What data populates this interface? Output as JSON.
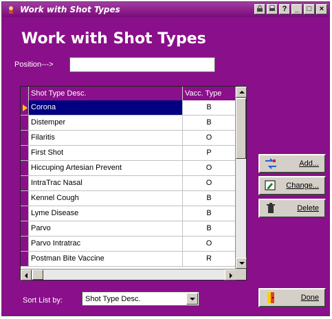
{
  "window": {
    "title": "Work with Shot Types",
    "controls": [
      "lock-icon",
      "print-icon",
      "help-icon",
      "minimize-icon",
      "maximize-icon",
      "close-icon"
    ],
    "control_glyphs": {
      "help": "?",
      "minimize": "_",
      "maximize": "□",
      "close": "×"
    }
  },
  "heading": "Work with Shot Types",
  "position": {
    "label": "Position--->",
    "value": ""
  },
  "grid": {
    "columns": [
      "Shot Type Desc.",
      "Vacc. Type"
    ],
    "rows": [
      {
        "desc": "Corona",
        "type": "B",
        "selected": true
      },
      {
        "desc": "Distemper",
        "type": "B"
      },
      {
        "desc": "Filaritis",
        "type": "O"
      },
      {
        "desc": "First Shot",
        "type": "P"
      },
      {
        "desc": "Hiccuping Artesian Prevent",
        "type": "O"
      },
      {
        "desc": "IntraTrac Nasal",
        "type": "O"
      },
      {
        "desc": "Kennel Cough",
        "type": "B"
      },
      {
        "desc": "Lyme Disease",
        "type": "B"
      },
      {
        "desc": "Parvo",
        "type": "B"
      },
      {
        "desc": "Parvo Intratrac",
        "type": "O"
      },
      {
        "desc": "Postman Bite Vaccine",
        "type": "R"
      }
    ]
  },
  "buttons": {
    "add": "Add...",
    "change": "Change...",
    "delete": "Delete",
    "done": "Done"
  },
  "sort": {
    "label": "Sort List by:",
    "value": "Shot Type Desc."
  },
  "colors": {
    "background": "#8a0f8a",
    "selection": "#000080",
    "button_face": "#d4d0c8"
  }
}
